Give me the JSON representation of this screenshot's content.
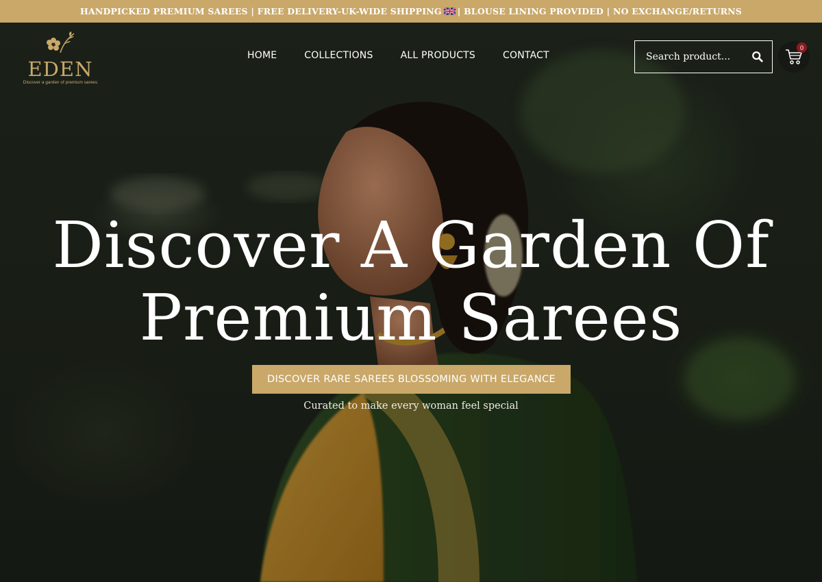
{
  "announcement": {
    "text_before_flag": "HANDPICKED PREMIUM SAREES | FREE DELIVERY-UK-WIDE SHIPPING",
    "text_after_flag": "| BLOUSE LINING PROVIDED | NO EXCHANGE/RETURNS",
    "background": "#c9a86a"
  },
  "logo": {
    "wordmark": "EDEN",
    "tagline": "Discover a garden of premium sarees"
  },
  "nav": {
    "items": [
      "HOME",
      "COLLECTIONS",
      "ALL PRODUCTS",
      "CONTACT"
    ]
  },
  "search": {
    "placeholder": "Search product..."
  },
  "cart": {
    "count": "0"
  },
  "hero": {
    "headline_line1": "Discover A Garden Of",
    "headline_line2": "Premium Sarees",
    "cta_label": "DISCOVER RARE SAREES BLOSSOMING WITH ELEGANCE",
    "subtext": "Curated to make every woman feel special"
  },
  "colors": {
    "accent": "#c9a86a",
    "badge": "#8b1a1f",
    "text": "#ffffff"
  }
}
